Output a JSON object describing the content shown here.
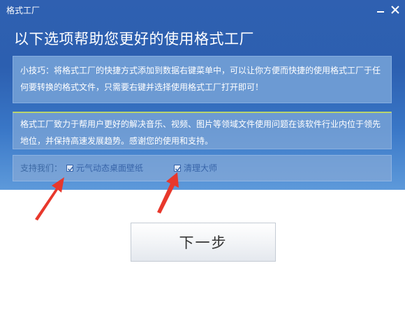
{
  "window": {
    "title": "格式工厂"
  },
  "header": {
    "headline": "以下选项帮助您更好的使用格式工厂"
  },
  "tip": {
    "text": "小技巧：将格式工厂的快捷方式添加到数据右键菜单中，可以让你方便而快捷的使用格式工厂于任何要转换的格式文件，只需要右键并选择使用格式工厂打开即可！"
  },
  "about": {
    "text": "格式工厂致力于帮用户更好的解决音乐、视频、图片等领域文件使用问题在该软件行业内位于领先地位，并保持高速发展趋势。感谢您的使用和支持。"
  },
  "support": {
    "label": "支持我们：",
    "options": [
      {
        "label": "元气动态桌面壁纸",
        "checked": true
      },
      {
        "label": "清理大师",
        "checked": true
      }
    ]
  },
  "buttons": {
    "next": "下一步"
  },
  "icons": {
    "minimize": "minimize-icon",
    "close": "close-icon",
    "arrow": "red-arrow-icon"
  },
  "colors": {
    "header_blue": "#2f60b1",
    "panel_blue": "#6c9ad3",
    "arrow_red": "#e8382c"
  }
}
